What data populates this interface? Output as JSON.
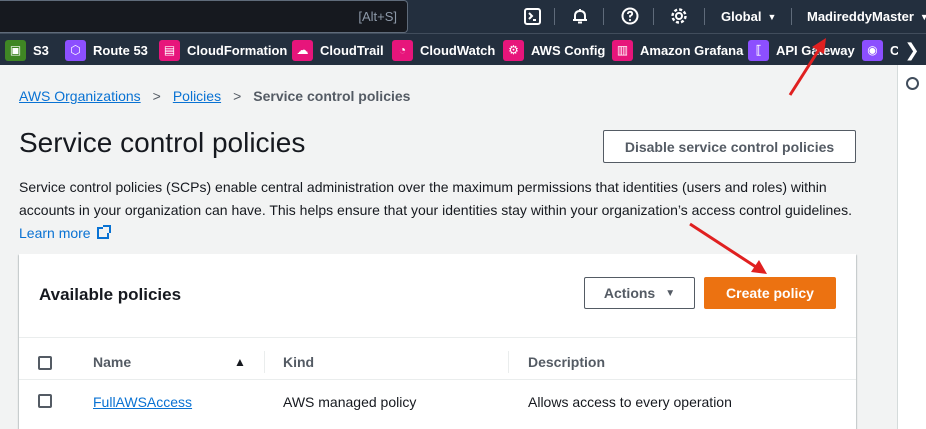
{
  "topbar": {
    "search_hint": "[Alt+S]",
    "icons": [
      "cloudshell-icon",
      "notifications-icon",
      "help-icon",
      "settings-icon"
    ],
    "region_label": "Global",
    "account_label": "MadireddyMaster"
  },
  "favorites": [
    {
      "label": "S3",
      "color": "#3f8624"
    },
    {
      "label": "Route 53",
      "color": "#8c4fff"
    },
    {
      "label": "CloudFormation",
      "color": "#e7157b"
    },
    {
      "label": "CloudTrail",
      "color": "#e7157b"
    },
    {
      "label": "CloudWatch",
      "color": "#e7157b"
    },
    {
      "label": "AWS Config",
      "color": "#e7157b"
    },
    {
      "label": "Amazon Grafana",
      "color": "#e7157b"
    },
    {
      "label": "API Gateway",
      "color": "#8c4fff"
    },
    {
      "label": "Clo",
      "color": "#8c4fff"
    }
  ],
  "breadcrumb": {
    "items": [
      "AWS Organizations",
      "Policies"
    ],
    "current": "Service control policies"
  },
  "page": {
    "title": "Service control policies",
    "disable_button": "Disable service control policies",
    "description": "Service control policies (SCPs) enable central administration over the maximum permissions that identities (users and roles) within accounts in your organization can have. This helps ensure that your identities stay within your organization’s access control guidelines.",
    "learn_more": "Learn more"
  },
  "panel": {
    "title": "Available policies",
    "actions_button": "Actions",
    "create_button": "Create policy",
    "columns": [
      "Name",
      "Kind",
      "Description"
    ],
    "sort_indicator": "▲",
    "rows": [
      {
        "name": "FullAWSAccess",
        "kind": "AWS managed policy",
        "description": "Allows access to every operation"
      }
    ]
  },
  "colors": {
    "accent": "#ec7211",
    "link": "#0972d3",
    "annotation_arrow": "#e02020",
    "header_bg": "#232f3e"
  }
}
